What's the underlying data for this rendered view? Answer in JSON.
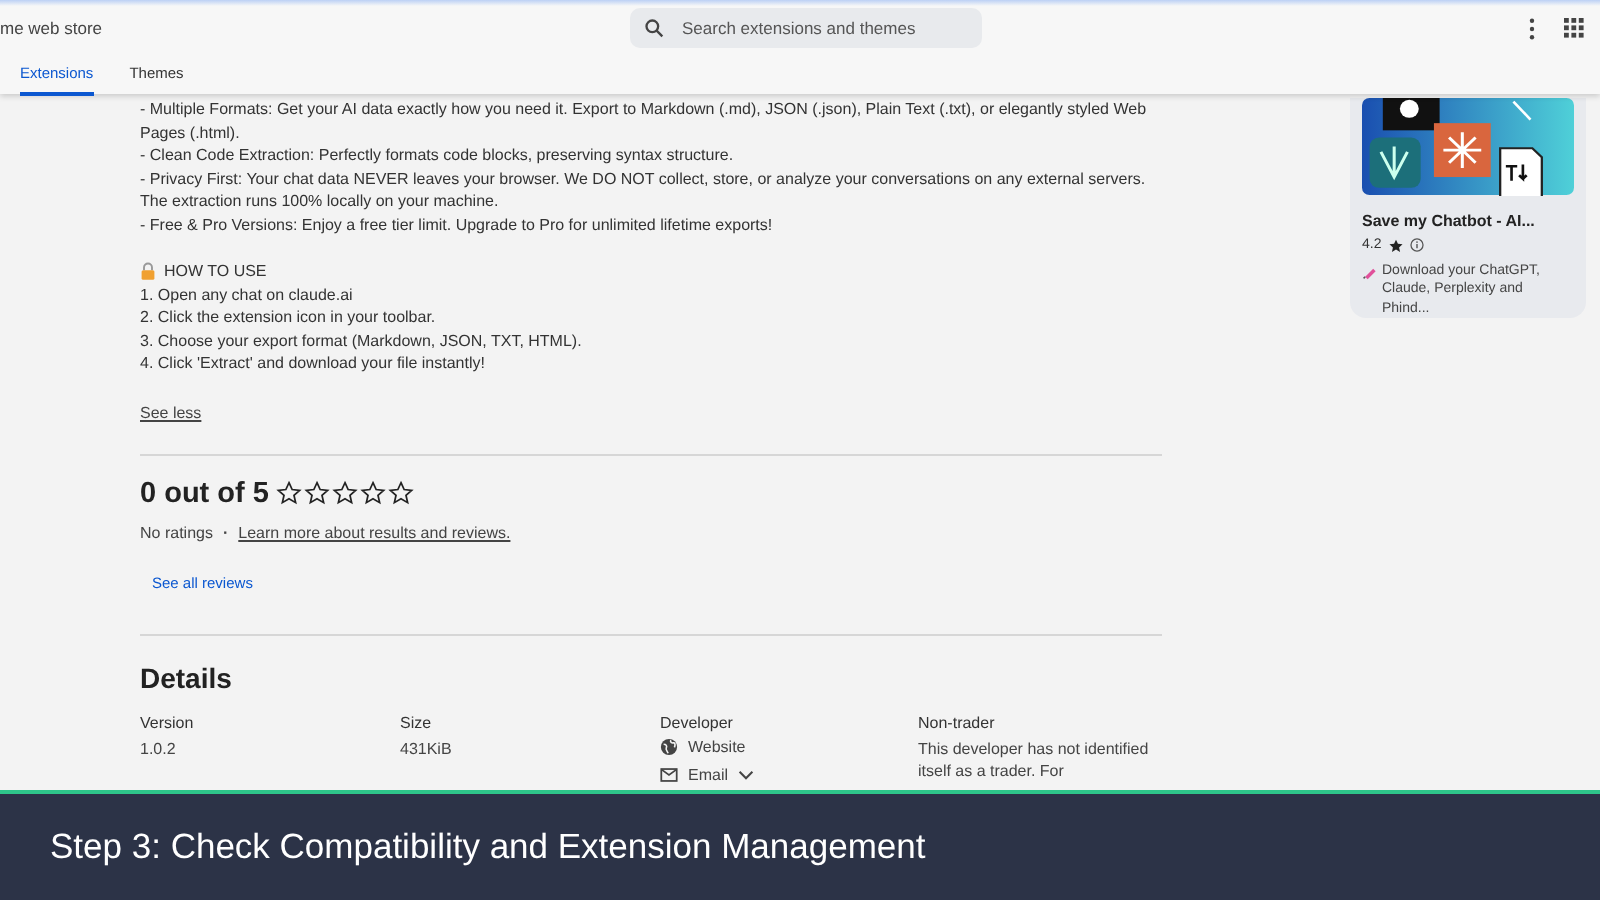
{
  "header": {
    "title": "me web store",
    "search": {
      "placeholder": "Search extensions and themes"
    },
    "tabs": [
      {
        "label": "Extensions",
        "selected": true
      },
      {
        "label": "Themes",
        "selected": false
      }
    ]
  },
  "description": {
    "bullets": [
      "- Multiple Formats: Get your AI data exactly how you need it. Export to Markdown (.md), JSON (.json), Plain Text (.txt), or elegantly styled Web Pages (.html).",
      "- Clean Code Extraction: Perfectly formats code blocks, preserving syntax structure.",
      "- Privacy First: Your chat data NEVER leaves your browser. We DO NOT collect, store, or analyze your conversations on any external servers. The extraction runs 100% locally on your machine.",
      "- Free & Pro Versions: Enjoy a free tier limit. Upgrade to Pro for unlimited lifetime exports!"
    ],
    "howto_heading": "HOW TO USE",
    "steps": [
      "1. Open any chat on claude.ai",
      "2. Click the extension icon in your toolbar.",
      "3. Choose your export format (Markdown, JSON, TXT, HTML).",
      "4. Click 'Extract' and download your file instantly!"
    ],
    "toggle": "See less"
  },
  "ratings": {
    "heading": "0 out of 5",
    "stars": 0,
    "no_ratings": "No ratings",
    "separator": "·",
    "learn_more": "Learn more about results and reviews.",
    "see_all": "See all reviews"
  },
  "details": {
    "heading": "Details",
    "columns": [
      {
        "label": "Version",
        "value": "1.0.2"
      },
      {
        "label": "Size",
        "value": "431KiB"
      },
      {
        "label": "Developer",
        "links": [
          "Website",
          "Email"
        ]
      },
      {
        "label": "Non-trader",
        "value": "This developer has not identified itself as a trader. For"
      }
    ]
  },
  "related_card": {
    "kind": "picture",
    "title": "Save my Chatbot - AI...",
    "rating": "4.2",
    "description": "Download your ChatGPT, Claude, Perplexity and Phind..."
  },
  "caption": "Step 3: Check Compatibility and Extension Management"
}
